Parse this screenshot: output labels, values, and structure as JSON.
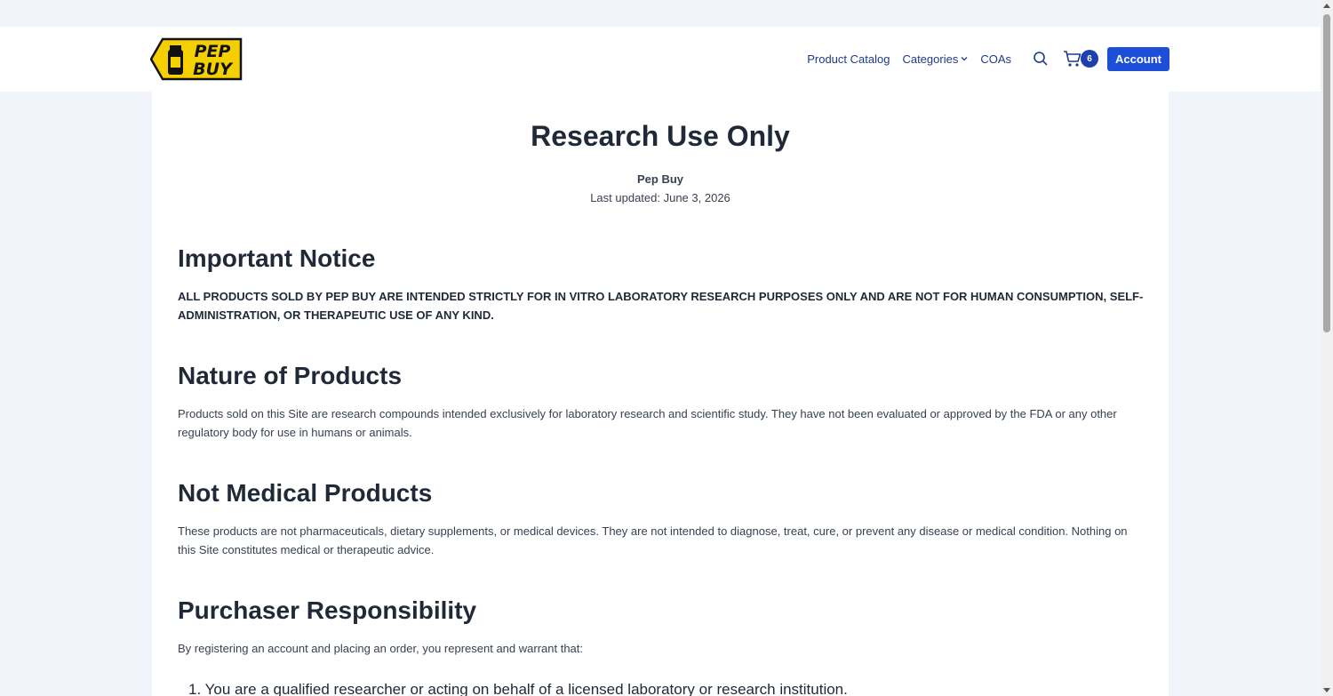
{
  "header": {
    "logo": {
      "line1": "PEP",
      "line2": "BUY",
      "brand_color": "#f5d000"
    },
    "nav": {
      "product_catalog": "Product Catalog",
      "categories": "Categories",
      "coas": "COAs"
    },
    "cart_count": "6",
    "account_label": "Account"
  },
  "page": {
    "title": "Research Use Only",
    "company": "Pep Buy",
    "last_updated": "Last updated: June 3, 2026"
  },
  "sections": [
    {
      "heading": "Important Notice",
      "body": "ALL PRODUCTS SOLD BY PEP BUY ARE INTENDED STRICTLY FOR IN VITRO LABORATORY RESEARCH PURPOSES ONLY AND ARE NOT FOR HUMAN CONSUMPTION, SELF-ADMINISTRATION, OR THERAPEUTIC USE OF ANY KIND."
    },
    {
      "heading": "Nature of Products",
      "body": "Products sold on this Site are research compounds intended exclusively for laboratory research and scientific study. They have not been evaluated or approved by the FDA or any other regulatory body for use in humans or animals."
    },
    {
      "heading": "Not Medical Products",
      "body": "These products are not pharmaceuticals, dietary supplements, or medical devices. They are not intended to diagnose, treat, cure, or prevent any disease or medical condition. Nothing on this Site constitutes medical or therapeutic advice."
    },
    {
      "heading": "Purchaser Responsibility",
      "body": "By registering an account and placing an order, you represent and warrant that:"
    }
  ],
  "list": [
    {
      "marker": "1.",
      "text": "You are a qualified researcher or acting on behalf of a licensed laboratory or research institution."
    }
  ],
  "colors": {
    "accent": "#1d4ed8",
    "link": "#1e3a8a",
    "page_bg": "#f1f5fb"
  }
}
